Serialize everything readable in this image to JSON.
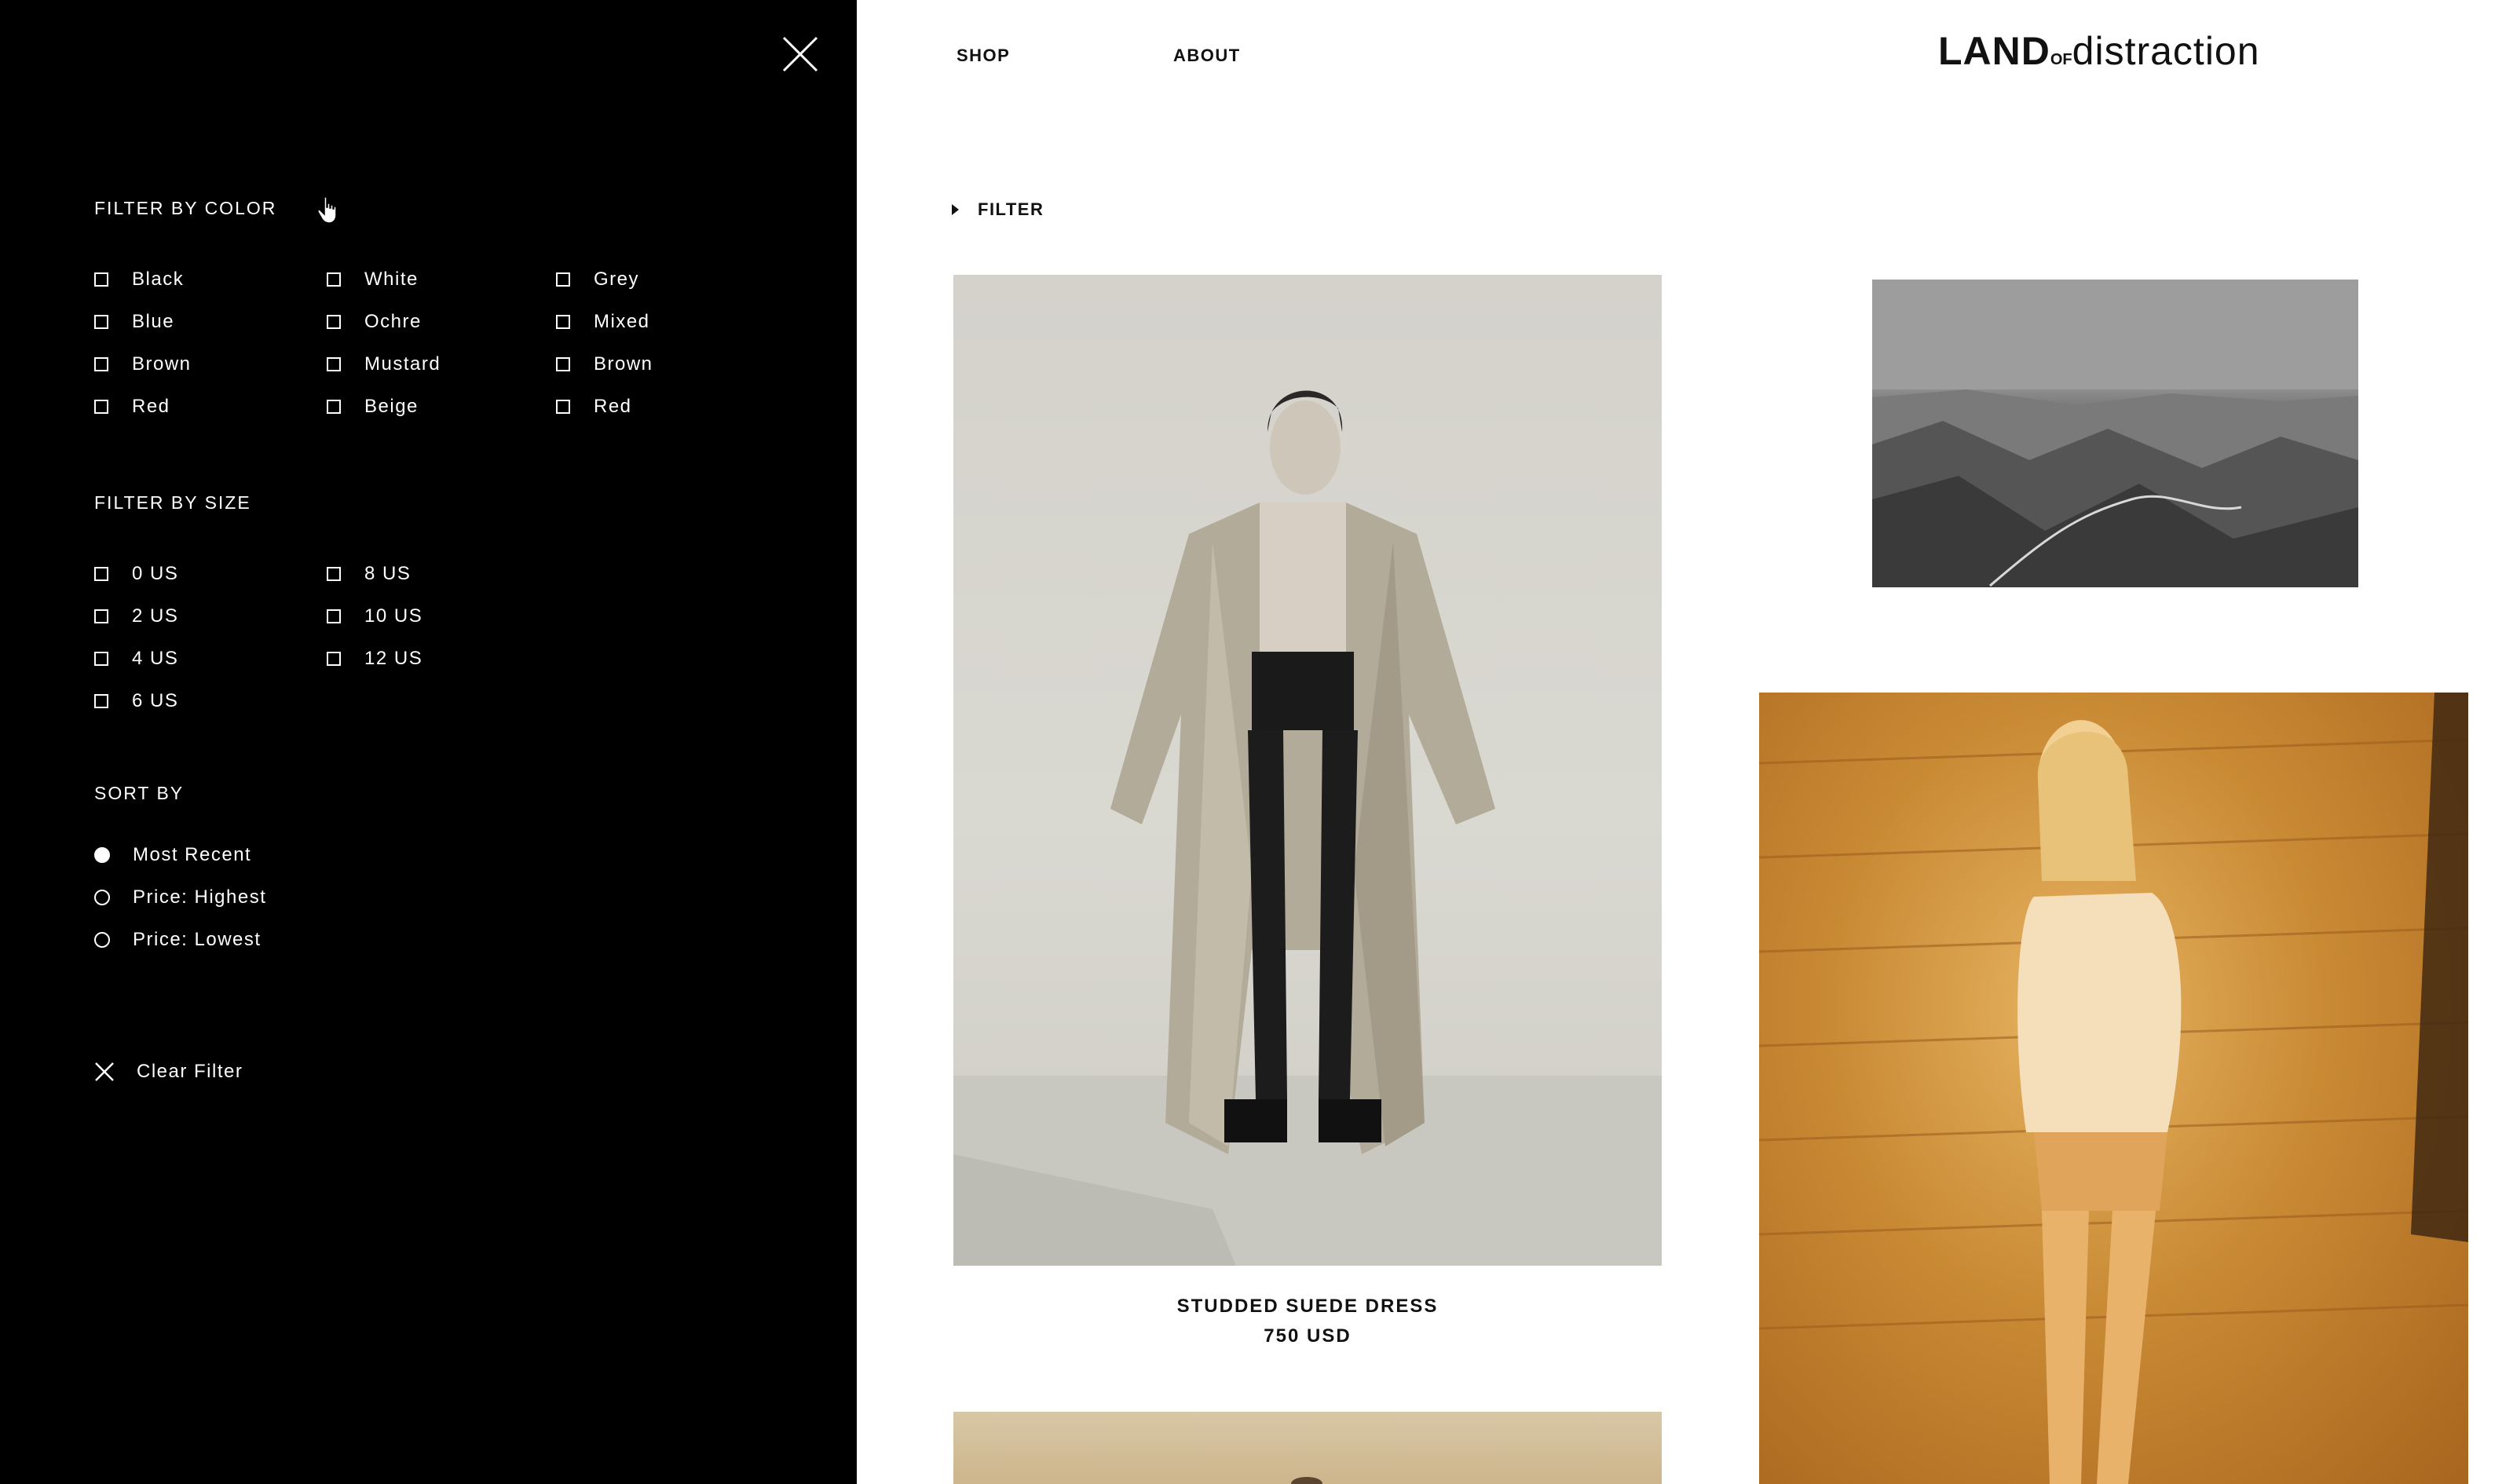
{
  "drawer": {
    "color_title": "FILTER BY COLOR",
    "colors": [
      [
        "Black",
        "Blue",
        "Brown",
        "Red"
      ],
      [
        "White",
        "Ochre",
        "Mustard",
        "Beige"
      ],
      [
        "Grey",
        "Mixed",
        "Brown",
        "Red"
      ]
    ],
    "size_title": "FILTER BY SIZE",
    "sizes": [
      [
        "0 US",
        "2 US",
        "4 US",
        "6 US"
      ],
      [
        "8 US",
        "10 US",
        "12 US"
      ]
    ],
    "sort_title": "SORT BY",
    "sort_options": [
      "Most Recent",
      "Price: Highest",
      "Price: Lowest"
    ],
    "sort_selected": "Most Recent",
    "clear_label": "Clear Filter"
  },
  "nav": {
    "shop": "SHOP",
    "about": "ABOUT"
  },
  "logo": {
    "part1": "LAND",
    "part2": "OF",
    "part3": "distraction"
  },
  "filter_toggle": "FILTER",
  "products": [
    {
      "name": "STUDDED SUEDE DRESS",
      "price": "750 USD"
    }
  ],
  "colors": {
    "drawer_bg": "#000000",
    "page_bg": "#ffffff",
    "text": "#111111"
  }
}
